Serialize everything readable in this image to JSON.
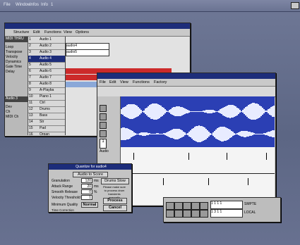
{
  "menubar": {
    "items": [
      "File",
      "Window",
      "Infos",
      "Info",
      "1"
    ]
  },
  "arrange": {
    "menu": [
      "Structure",
      "Edit",
      "Functions",
      "View",
      "Options"
    ],
    "tracks": [
      {
        "num": "1",
        "name": "Audio 1"
      },
      {
        "num": "2",
        "name": "Audio 2"
      },
      {
        "num": "3",
        "name": "Audio 3"
      },
      {
        "num": "4",
        "name": "Audio 4"
      },
      {
        "num": "5",
        "name": "Audio 5"
      },
      {
        "num": "6",
        "name": "Audio 6"
      },
      {
        "num": "7",
        "name": "Audio 7"
      },
      {
        "num": "8",
        "name": "Audio 8"
      },
      {
        "num": "9",
        "name": "A-Playba"
      },
      {
        "num": "10",
        "name": "Piano 1"
      },
      {
        "num": "11",
        "name": "Ctrl"
      },
      {
        "num": "12",
        "name": "Drums"
      },
      {
        "num": "13",
        "name": "Bass"
      },
      {
        "num": "14",
        "name": "Str"
      },
      {
        "num": "15",
        "name": "Pad"
      },
      {
        "num": "16",
        "name": "Organ"
      }
    ],
    "parts": [
      "audio4",
      "audio5"
    ],
    "left_labels": [
      "MIDI THRU",
      "Loop",
      "Transpose",
      "Velocity",
      "Dynamics",
      "Gate Time",
      "Delay"
    ],
    "left_labels2": [
      "Audio 3",
      "Dev",
      "Ch",
      "MIDI Ch"
    ]
  },
  "editor": {
    "menu": [
      "File",
      "Edit",
      "View",
      "Functions",
      "Factory"
    ],
    "scale": [
      "1",
      "2",
      "3",
      "4"
    ],
    "lane_label": "Audio"
  },
  "dialog": {
    "title": "Quantize for audio4",
    "subtitle": "Audio to Score",
    "fields": [
      {
        "label": "Granulation",
        "value": "120",
        "unit": "ms"
      },
      {
        "label": "Attack Range",
        "value": "20",
        "unit": "ms"
      },
      {
        "label": "Smooth Release",
        "value": "0",
        "unit": "%"
      },
      {
        "label": "Velocity Threshold",
        "value": "1",
        "unit": ""
      }
    ],
    "quality_label": "Minimum Quality",
    "quality_value": "Normal",
    "time_label": "Time Correction",
    "time_value": "0",
    "time_unit": "ms",
    "btn_drums": "Drums Slow",
    "help": "Please make sure to process drum transients manually",
    "btn_process": "Process",
    "btn_cancel": "Cancel"
  },
  "transport": {
    "pos1": "1 1 1 1",
    "pos2": "1 3 1 1",
    "lbl1": "SMPTE",
    "lbl2": "LOCAL"
  }
}
